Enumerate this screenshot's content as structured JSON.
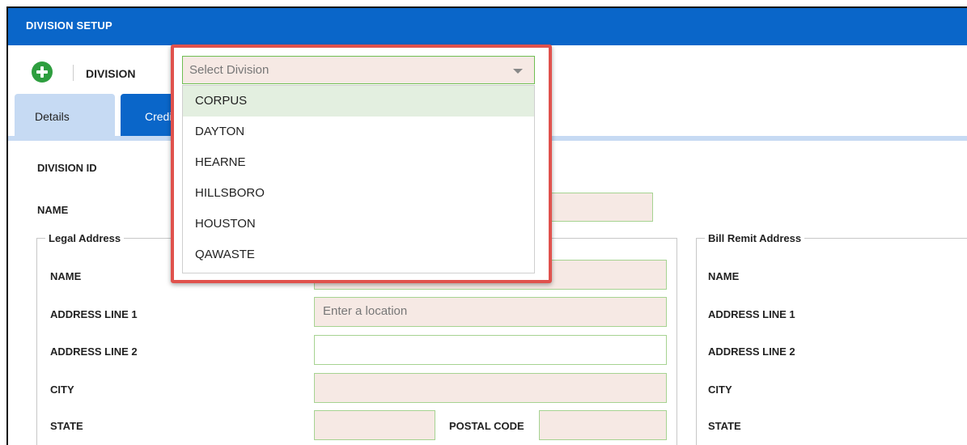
{
  "title": "DIVISION SETUP",
  "toolbar": {
    "division_label": "DIVISION"
  },
  "tabs": [
    {
      "label": "Details"
    },
    {
      "label": "Credit"
    }
  ],
  "division_select": {
    "placeholder": "Select Division",
    "highlighted": "CORPUS",
    "options": [
      "CORPUS",
      "DAYTON",
      "HEARNE",
      "HILLSBORO",
      "HOUSTON",
      "QAWASTE"
    ]
  },
  "details": {
    "division_id_label": "DIVISION ID",
    "name_label": "NAME"
  },
  "legal_address": {
    "legend": "Legal Address",
    "name_label": "NAME",
    "address1_label": "ADDRESS LINE 1",
    "address1_placeholder": "Enter a location",
    "address2_label": "ADDRESS LINE 2",
    "city_label": "CITY",
    "state_label": "STATE",
    "postal_label": "POSTAL CODE"
  },
  "bill_remit_address": {
    "legend": "Bill Remit Address",
    "name_label": "NAME",
    "address1_label": "ADDRESS LINE 1",
    "address2_label": "ADDRESS LINE 2",
    "city_label": "CITY",
    "state_label": "STATE"
  },
  "colors": {
    "header_blue": "#0a66c9",
    "tab_light": "#c6daf3",
    "field_fill": "#f6e9e4",
    "field_border": "#a6d391",
    "add_green": "#2e9e3f",
    "highlight_red": "#e0524d"
  }
}
